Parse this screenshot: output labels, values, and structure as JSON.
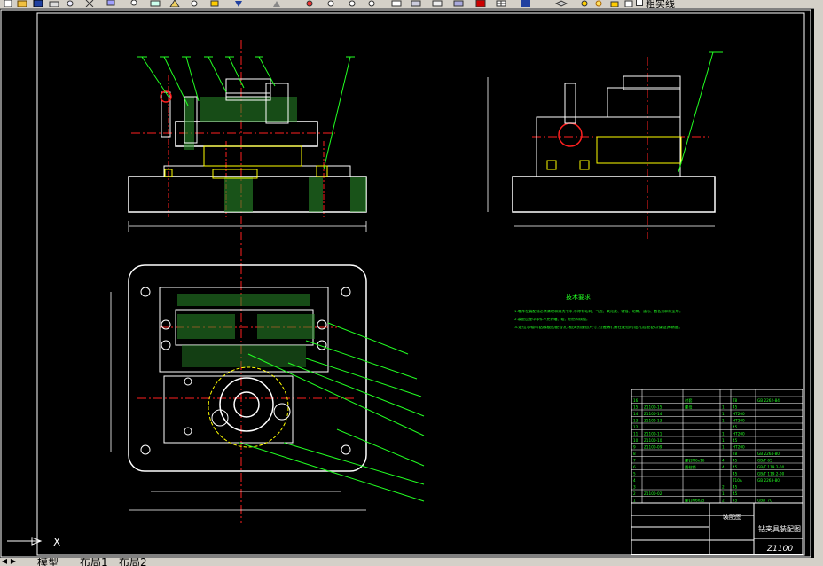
{
  "toolbar": {
    "icons": [
      "new-file-icon",
      "open-icon",
      "save-icon",
      "print-icon",
      "preview-icon",
      "zoom-realtime-icon",
      "zoom-window-icon",
      "zoom-previous-icon",
      "zoom-extents-icon",
      "text-style-icon",
      "dimension-style-icon",
      "properties-icon",
      "layer-icon",
      "table-icon",
      "help-icon",
      "layer-manager-icon",
      "bulb-icon",
      "sun-icon",
      "lock-icon"
    ],
    "layer_name": "粗实线",
    "layer_color": "#ffffff"
  },
  "drawing": {
    "tech_req_title": "技术要求",
    "tech_req_lines": [
      "1.零件在装配前必须清理和清洗干净,不得有毛刺、飞边、氧化皮、锈蚀、切屑、油污、着色剂和灰尘等。",
      "2.装配过程中零件不允许磕、碰、划伤和锈蚀。",
      "3.定位心轴与钻模板的配合孔(相关的配合尺寸,公差等),需在配合时钻孔后配钻以保证其精度。"
    ],
    "title_block": {
      "drawing_name": "钻夹具装配图",
      "drawing_number": "Z1100",
      "material_label": "装配图"
    },
    "bom_rows": [
      {
        "no": "16",
        "code": "",
        "name": "衬套",
        "qty": "",
        "mat": "T8",
        "std": "GB 2262-84"
      },
      {
        "no": "15",
        "code": "Z1100-15",
        "name": "螺母",
        "qty": "1",
        "mat": "45",
        "std": ""
      },
      {
        "no": "14",
        "code": "Z1100-14",
        "name": "",
        "qty": "1",
        "mat": "HT200",
        "std": ""
      },
      {
        "no": "13",
        "code": "Z1100-13",
        "name": "",
        "qty": "1",
        "mat": "HT200",
        "std": ""
      },
      {
        "no": "12",
        "code": "",
        "name": "",
        "qty": "",
        "mat": "45",
        "std": ""
      },
      {
        "no": "11",
        "code": "Z1100-11",
        "name": "",
        "qty": "1",
        "mat": "HT200",
        "std": ""
      },
      {
        "no": "10",
        "code": "Z1100-10",
        "name": "",
        "qty": "1",
        "mat": "45",
        "std": ""
      },
      {
        "no": "9",
        "code": "Z1100-09",
        "name": "",
        "qty": "1",
        "mat": "HT200",
        "std": ""
      },
      {
        "no": "8",
        "code": "",
        "name": "",
        "qty": "",
        "mat": "T8",
        "std": "GB 2264-80"
      },
      {
        "no": "7",
        "code": "",
        "name": "螺钉M6x16",
        "qty": "4",
        "mat": "45",
        "std": "GB/T 65"
      },
      {
        "no": "6",
        "code": "",
        "name": "圆柱销",
        "qty": "4",
        "mat": "45",
        "std": "GB/T 119.2-00"
      },
      {
        "no": "5",
        "code": "",
        "name": "",
        "qty": "",
        "mat": "45",
        "std": "GB/T 119.2-00"
      },
      {
        "no": "4",
        "code": "",
        "name": "",
        "qty": "",
        "mat": "T10A",
        "std": "GB 2263-80"
      },
      {
        "no": "3",
        "code": "",
        "name": "",
        "qty": "2",
        "mat": "45",
        "std": ""
      },
      {
        "no": "2",
        "code": "Z1100-02",
        "name": "",
        "qty": "1",
        "mat": "45",
        "std": ""
      },
      {
        "no": "1",
        "code": "",
        "name": "螺钉M6x25",
        "qty": "2",
        "mat": "45",
        "std": "GB/T 70"
      }
    ]
  },
  "tabs": {
    "model": "模型",
    "layout1": "布局1",
    "layout2": "布局2"
  }
}
